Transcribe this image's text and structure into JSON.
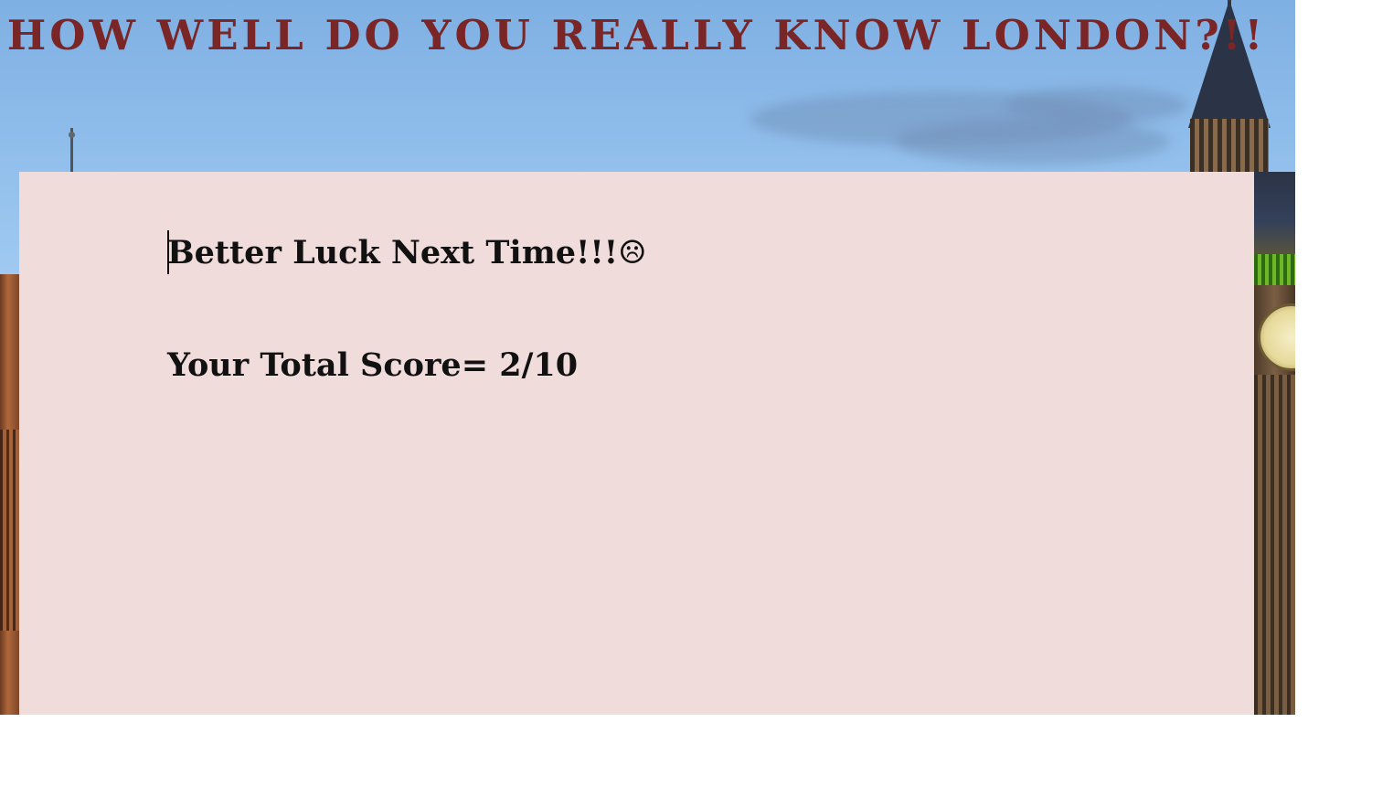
{
  "header": {
    "title": "HOW WELL DO YOU REALLY KNOW LONDON?!!"
  },
  "result": {
    "message": "Better Luck Next Time!!!☹",
    "score_text": "Your Total Score= 2/10"
  },
  "colors": {
    "title": "#7a2626",
    "card_background": "#f1dcdc",
    "text": "#111111"
  },
  "background": {
    "image": "london-skyline-big-ben"
  }
}
